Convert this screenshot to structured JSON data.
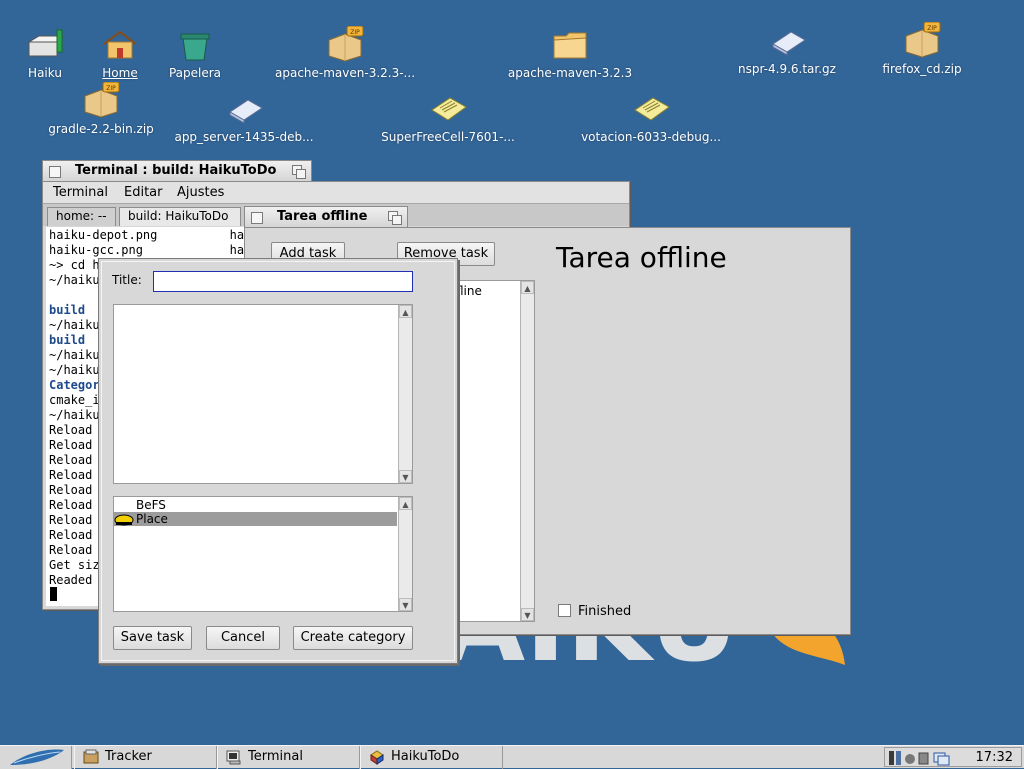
{
  "desktop": {
    "icons": [
      {
        "label": "Haiku",
        "kind": "drive"
      },
      {
        "label": "Home",
        "kind": "home"
      },
      {
        "label": "Papelera",
        "kind": "trash"
      },
      {
        "label": "apache-maven-3.2.3-...",
        "kind": "zip"
      },
      {
        "label": "apache-maven-3.2.3",
        "kind": "folder"
      },
      {
        "label": "nspr-4.9.6.tar.gz",
        "kind": "archive"
      },
      {
        "label": "firefox_cd.zip",
        "kind": "zip"
      },
      {
        "label": "gradle-2.2-bin.zip",
        "kind": "zip"
      },
      {
        "label": "app_server-1435-deb...",
        "kind": "archive"
      },
      {
        "label": "SuperFreeCell-7601-...",
        "kind": "text"
      },
      {
        "label": "votacion-6033-debug...",
        "kind": "text"
      }
    ]
  },
  "terminal": {
    "window_title": "Terminal : build: HaikuToDo",
    "menu": [
      "Terminal",
      "Editar",
      "Ajustes"
    ],
    "tabs": [
      "home: --",
      "build: HaikuToDo"
    ],
    "lines": [
      {
        "text": "haiku-depot.png          haiku",
        "style": "normal"
      },
      {
        "text": "haiku-gcc.png            haiku",
        "style": "normal"
      },
      {
        "text": "~> cd h",
        "style": "normal"
      },
      {
        "text": "~/haiku",
        "style": "normal"
      },
      {
        "text": "",
        "style": "normal"
      },
      {
        "text": "build",
        "style": "blue"
      },
      {
        "text": "~/haiku",
        "style": "normal"
      },
      {
        "text": "build",
        "style": "blue"
      },
      {
        "text": "~/haiku",
        "style": "normal"
      },
      {
        "text": "~/haiku",
        "style": "normal"
      },
      {
        "text": "Categor",
        "style": "blue"
      },
      {
        "text": "cmake_i",
        "style": "normal"
      },
      {
        "text": "~/haiku",
        "style": "normal"
      },
      {
        "text": "Reload",
        "style": "normal"
      },
      {
        "text": "Reload",
        "style": "normal"
      },
      {
        "text": "Reload",
        "style": "normal"
      },
      {
        "text": "Reload",
        "style": "normal"
      },
      {
        "text": "Reload",
        "style": "normal"
      },
      {
        "text": "Reload",
        "style": "normal"
      },
      {
        "text": "Reload",
        "style": "normal"
      },
      {
        "text": "Reload",
        "style": "normal"
      },
      {
        "text": "Reload",
        "style": "normal"
      },
      {
        "text": "Get siz",
        "style": "normal"
      },
      {
        "text": "Readed",
        "style": "normal"
      }
    ]
  },
  "todo": {
    "window_title": "Tarea offline",
    "add_task": "Add task",
    "remove_task": "Remove task",
    "task_list_item": "fline",
    "heading": "Tarea offline",
    "finished_label": "Finished"
  },
  "dialog": {
    "title_label": "Title:",
    "title_value": "",
    "categories": [
      {
        "label": "BeFS",
        "selected": false
      },
      {
        "label": "Place",
        "selected": true
      }
    ],
    "save_button": "Save task",
    "cancel_button": "Cancel",
    "create_category_button": "Create category"
  },
  "taskbar": {
    "items": [
      {
        "label": "Tracker",
        "icon": "tracker-icon"
      },
      {
        "label": "Terminal",
        "icon": "terminal-icon"
      },
      {
        "label": "HaikuToDo",
        "icon": "haikutodo-icon"
      }
    ],
    "clock": "17:32"
  }
}
